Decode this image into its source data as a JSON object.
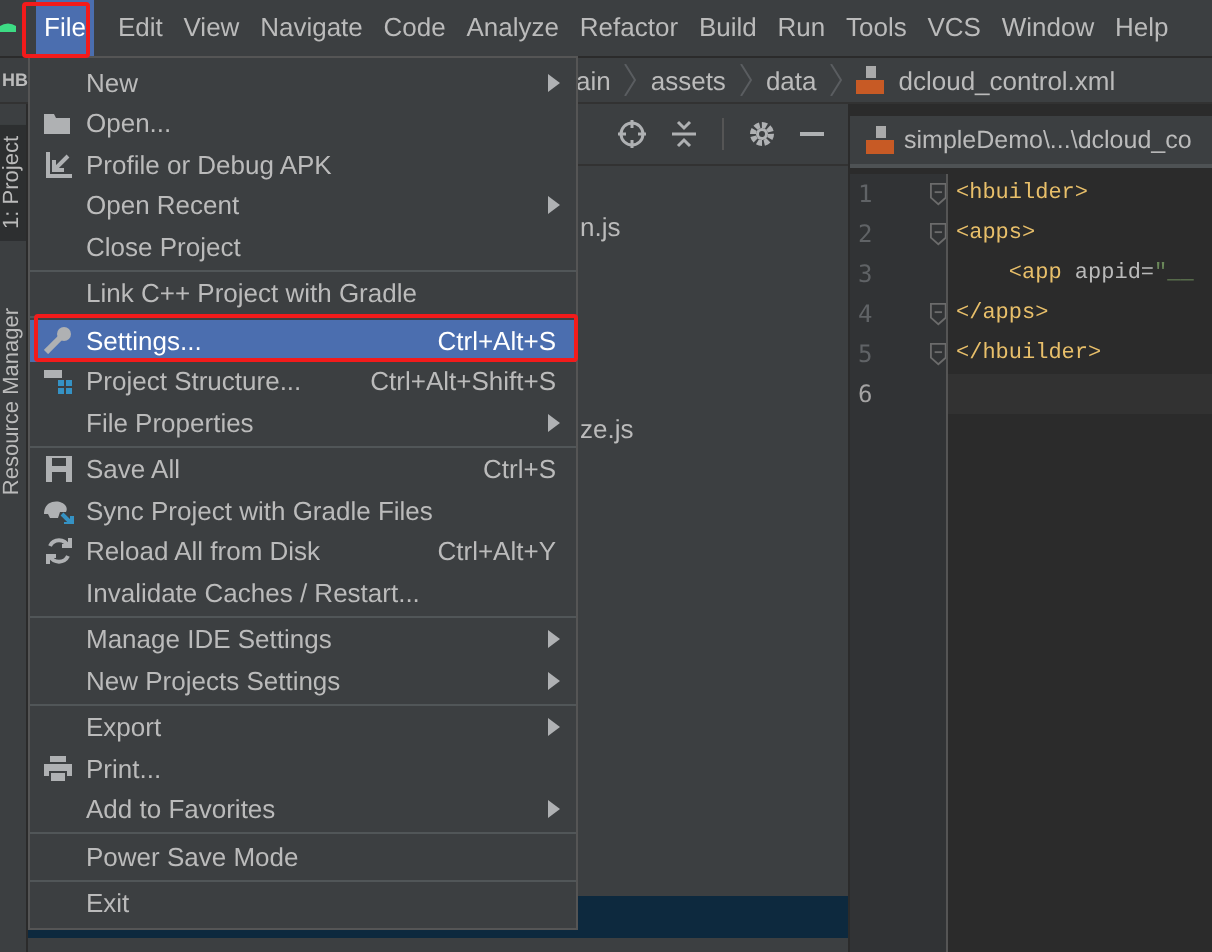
{
  "menubar": [
    {
      "label": "File",
      "selected": true
    },
    {
      "label": "Edit",
      "selected": false
    },
    {
      "label": "View",
      "selected": false
    },
    {
      "label": "Navigate",
      "selected": false
    },
    {
      "label": "Code",
      "selected": false
    },
    {
      "label": "Analyze",
      "selected": false
    },
    {
      "label": "Refactor",
      "selected": false
    },
    {
      "label": "Build",
      "selected": false
    },
    {
      "label": "Run",
      "selected": false
    },
    {
      "label": "Tools",
      "selected": false
    },
    {
      "label": "VCS",
      "selected": false
    },
    {
      "label": "Window",
      "selected": false
    },
    {
      "label": "Help",
      "selected": false
    }
  ],
  "navbar": {
    "project": "HB",
    "crumbs": [
      "ain",
      "assets",
      "data",
      "dcloud_control.xml"
    ]
  },
  "tool_strip": [
    {
      "label": "1: Project",
      "selected": true
    },
    {
      "label": "Resource Manager",
      "selected": false
    }
  ],
  "project_rows": [
    {
      "name": "n.js",
      "selected": false
    },
    {
      "name": "ze.js",
      "selected": false
    },
    {
      "selected": true
    }
  ],
  "editor": {
    "tab": "simpleDemo\\...\\dcloud_co",
    "lines": [
      {
        "number": "1",
        "current": false,
        "fold": true,
        "parts": [
          {
            "kind": "tag",
            "text": "<hbuilder>"
          }
        ]
      },
      {
        "number": "2",
        "current": false,
        "fold": true,
        "parts": [
          {
            "kind": "tag",
            "text": "<apps>"
          }
        ]
      },
      {
        "number": "3",
        "current": false,
        "fold": false,
        "parts": [
          {
            "kind": "tag",
            "text": "    <app "
          },
          {
            "kind": "attr",
            "text": "appid="
          },
          {
            "kind": "string",
            "text": "\"__"
          }
        ]
      },
      {
        "number": "4",
        "current": false,
        "fold": true,
        "parts": [
          {
            "kind": "tag",
            "text": "</apps>"
          }
        ]
      },
      {
        "number": "5",
        "current": false,
        "fold": true,
        "parts": [
          {
            "kind": "tag",
            "text": "</hbuilder>"
          }
        ]
      },
      {
        "number": "6",
        "current": true,
        "fold": false
      }
    ]
  },
  "file_menu": [
    {
      "kind": "item",
      "label": "New",
      "submenu": true,
      "selected": false
    },
    {
      "kind": "item",
      "label": "Open...",
      "submenu": false,
      "selected": false
    },
    {
      "kind": "item",
      "label": "Profile or Debug APK",
      "submenu": false,
      "selected": false
    },
    {
      "kind": "item",
      "label": "Open Recent",
      "submenu": true,
      "selected": false
    },
    {
      "kind": "item",
      "label": "Close Project",
      "submenu": false,
      "selected": false
    },
    {
      "kind": "separator"
    },
    {
      "kind": "item",
      "label": "Link C++ Project with Gradle",
      "submenu": false,
      "selected": false
    },
    {
      "kind": "separator"
    },
    {
      "kind": "item",
      "label": "Settings...",
      "shortcut": "Ctrl+Alt+S",
      "submenu": false,
      "selected": true
    },
    {
      "kind": "item",
      "label": "Project Structure...",
      "shortcut": "Ctrl+Alt+Shift+S",
      "submenu": false,
      "selected": false
    },
    {
      "kind": "item",
      "label": "File Properties",
      "submenu": true,
      "selected": false
    },
    {
      "kind": "separator"
    },
    {
      "kind": "item",
      "label": "Save All",
      "shortcut": "Ctrl+S",
      "submenu": false,
      "selected": false
    },
    {
      "kind": "item",
      "label": "Sync Project with Gradle Files",
      "submenu": false,
      "selected": false
    },
    {
      "kind": "item",
      "label": "Reload All from Disk",
      "shortcut": "Ctrl+Alt+Y",
      "submenu": false,
      "selected": false
    },
    {
      "kind": "item",
      "label": "Invalidate Caches / Restart...",
      "submenu": false,
      "selected": false
    },
    {
      "kind": "separator"
    },
    {
      "kind": "item",
      "label": "Manage IDE Settings",
      "submenu": true,
      "selected": false
    },
    {
      "kind": "item",
      "label": "New Projects Settings",
      "submenu": true,
      "selected": false
    },
    {
      "kind": "separator"
    },
    {
      "kind": "item",
      "label": "Export",
      "submenu": true,
      "selected": false
    },
    {
      "kind": "item",
      "label": "Print...",
      "submenu": false,
      "selected": false
    },
    {
      "kind": "item",
      "label": "Add to Favorites",
      "submenu": true,
      "selected": false
    },
    {
      "kind": "separator"
    },
    {
      "kind": "item",
      "label": "Power Save Mode",
      "submenu": false,
      "selected": false
    },
    {
      "kind": "separator"
    },
    {
      "kind": "item",
      "label": "Exit",
      "submenu": false,
      "selected": false
    }
  ]
}
